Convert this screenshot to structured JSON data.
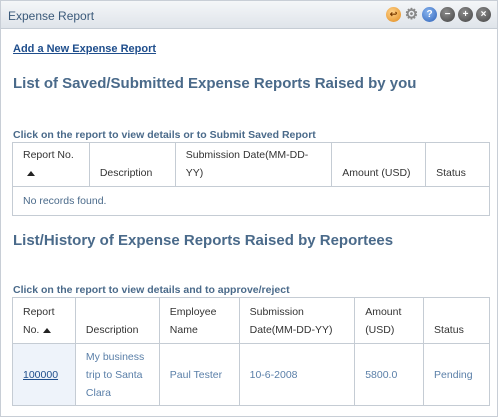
{
  "window": {
    "title": "Expense Report",
    "icons": [
      "return-icon",
      "gear-icon",
      "help-icon",
      "minimize-icon",
      "maximize-icon",
      "close-icon"
    ]
  },
  "actions": {
    "add_link": "Add a New Expense Report"
  },
  "saved": {
    "heading": "List of Saved/Submitted Expense Reports Raised by you",
    "instruction": "Click on the report to view details or to Submit Saved Report",
    "columns": [
      "Report No.",
      "Description",
      "Submission Date(MM-DD-YY)",
      "Amount (USD)",
      "Status"
    ],
    "empty_message": "No records found."
  },
  "history": {
    "heading": "List/History of Expense Reports Raised by Reportees",
    "instruction": "Click on the report to view details and to approve/reject",
    "columns": [
      "Report No.",
      "Description",
      "Employee Name",
      "Submission Date(MM-DD-YY)",
      "Amount (USD)",
      "Status"
    ],
    "rows": [
      {
        "report_no": "100000",
        "description": "My business trip to Santa Clara",
        "employee": "Paul Tester",
        "date": "10-6-2008",
        "amount": "5800.0",
        "status": "Pending"
      }
    ]
  },
  "colors": {
    "heading": "#4a6a8a",
    "link": "#1f4e8c",
    "cell_text": "#5a7fa8",
    "border": "#c5ccd4"
  }
}
